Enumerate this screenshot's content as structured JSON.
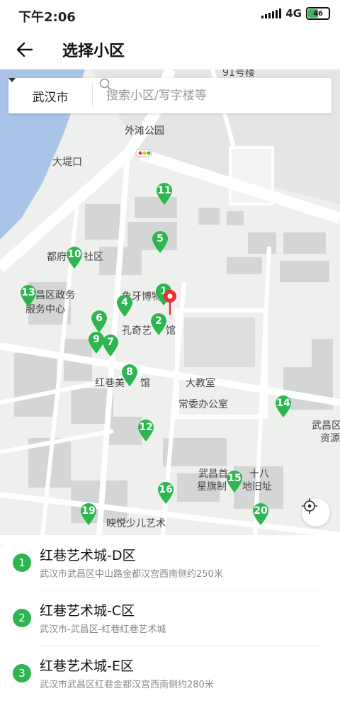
{
  "status_bar": {
    "time": "下午2:06",
    "network": "4G",
    "battery": "46",
    "battery_level": 0.46
  },
  "header": {
    "title": "选择小区",
    "back_icon": "arrow-left-icon"
  },
  "search": {
    "city": "武汉市",
    "placeholder": "搜索小区/写字楼等"
  },
  "map": {
    "labels": {
      "l91": "91号楼",
      "waitan": "外滩公园",
      "dadikou": "大堤口",
      "dufu": "都府",
      "dufu2": "社区",
      "qu": "昌区政务",
      "fuwu": "服务中心",
      "xiangya": "象牙博物",
      "kongqi": "孔奇艺",
      "guan": "馆",
      "hongxiang": "红巷美",
      "guan2": "馆",
      "dajiaoshi": "大教室",
      "changwei": "常委办公室",
      "wuchangqu": "武昌区",
      "ziyuan": "资源",
      "wuchangshou": "武昌首",
      "shiba": "十八",
      "xingqi": "星旗制",
      "dijiu": "地旧址",
      "yingyue": "映悦少儿艺术"
    },
    "pins": [
      "11",
      "5",
      "10",
      "1",
      "13",
      "4",
      "2",
      "6",
      "9",
      "7",
      "8",
      "14",
      "12",
      "15",
      "16",
      "19",
      "20"
    ],
    "accent_color": "#2db64f",
    "selected_color": "#e8302c"
  },
  "results": [
    {
      "index": "1",
      "name": "红巷艺术城-D区",
      "address": "武汉市武昌区中山路金都汉宫西南侧约250米"
    },
    {
      "index": "2",
      "name": "红巷艺术城-C区",
      "address": "武汉市-武昌区-红巷红巷艺术城"
    },
    {
      "index": "3",
      "name": "红巷艺术城-E区",
      "address": "武汉市武昌区红巷金都汉宫西南侧约280米"
    }
  ]
}
